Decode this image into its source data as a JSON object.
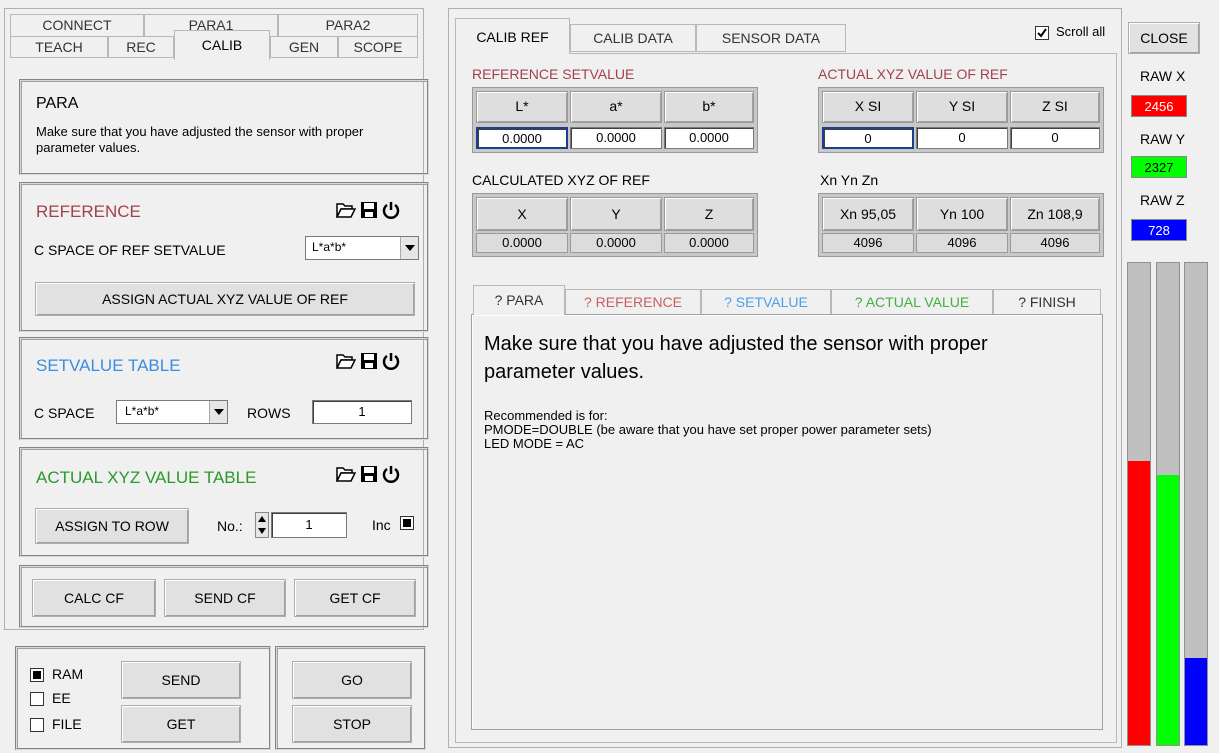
{
  "left_tabs": {
    "row1": [
      "CONNECT",
      "PARA1",
      "PARA2"
    ],
    "row2": [
      "TEACH",
      "REC",
      "CALIB",
      "GEN",
      "SCOPE"
    ],
    "active": "CALIB"
  },
  "para_box": {
    "title": "PARA",
    "desc": "Make sure that you have adjusted the sensor with proper parameter values."
  },
  "reference": {
    "title": "REFERENCE",
    "title_color": "#a0424a",
    "cspace_label": "C SPACE OF REF SETVALUE",
    "cspace_value": "L*a*b*",
    "assign_button": "ASSIGN ACTUAL XYZ VALUE OF REF"
  },
  "setvalue_table": {
    "title": "SETVALUE TABLE",
    "title_color": "#3a8ee0",
    "cspace_label": "C SPACE",
    "cspace_value": "L*a*b*",
    "rows_label": "ROWS",
    "rows_value": "1"
  },
  "actual_table": {
    "title": "ACTUAL XYZ VALUE TABLE",
    "title_color": "#2a9a2a",
    "assign_button": "ASSIGN TO ROW",
    "no_label": "No.:",
    "no_value": "1",
    "inc_label": "Inc"
  },
  "cf_buttons": {
    "calc": "CALC CF",
    "send": "SEND CF",
    "get": "GET CF"
  },
  "bottom": {
    "ram": "RAM",
    "ee": "EE",
    "file": "FILE",
    "send": "SEND",
    "get": "GET",
    "go": "GO",
    "stop": "STOP"
  },
  "right_tabs": {
    "tabs": [
      "CALIB REF",
      "CALIB DATA",
      "SENSOR DATA"
    ],
    "active": "CALIB REF"
  },
  "scroll_all": "Scroll all",
  "close": "CLOSE",
  "ref_setvalue": {
    "title": "REFERENCE SETVALUE",
    "headers": [
      "L*",
      "a*",
      "b*"
    ],
    "values": [
      "0.0000",
      "0.0000",
      "0.0000"
    ]
  },
  "actual_xyz": {
    "title": "ACTUAL XYZ VALUE OF REF",
    "headers": [
      "X SI",
      "Y SI",
      "Z SI"
    ],
    "values": [
      "0",
      "0",
      "0"
    ]
  },
  "calc_xyz": {
    "title": "CALCULATED XYZ  OF REF",
    "headers": [
      "X",
      "Y",
      "Z"
    ],
    "values": [
      "0.0000",
      "0.0000",
      "0.0000"
    ]
  },
  "xn": {
    "title": "Xn Yn Zn",
    "headers": [
      "Xn 95,05",
      "Yn 100",
      "Zn 108,9"
    ],
    "values": [
      "4096",
      "4096",
      "4096"
    ]
  },
  "help_tabs": [
    {
      "label": "? PARA",
      "color": "#000000"
    },
    {
      "label": "? REFERENCE",
      "color": "#c86060"
    },
    {
      "label": "? SETVALUE",
      "color": "#4aa0f0"
    },
    {
      "label": "? ACTUAL VALUE",
      "color": "#40b040"
    },
    {
      "label": "? FINISH",
      "color": "#333333"
    }
  ],
  "help": {
    "heading": "Make sure that you have adjusted the sensor with proper parameter values.",
    "line1": "Recommended is for:",
    "line2": "PMODE=DOUBLE (be aware that you have set proper power parameter sets)",
    "line3": "LED MODE = AC"
  },
  "raw": {
    "x_label": "RAW X",
    "x_value": "2456",
    "x_color": "#ff0000",
    "y_label": "RAW Y",
    "y_value": "2327",
    "y_color": "#00ff00",
    "z_label": "RAW Z",
    "z_value": "728",
    "z_color": "#0000ff"
  },
  "bars": [
    {
      "color": "#ff0000",
      "level": 0.59
    },
    {
      "color": "#00ff00",
      "level": 0.56
    },
    {
      "color": "#0000ff",
      "level": 0.18
    }
  ]
}
